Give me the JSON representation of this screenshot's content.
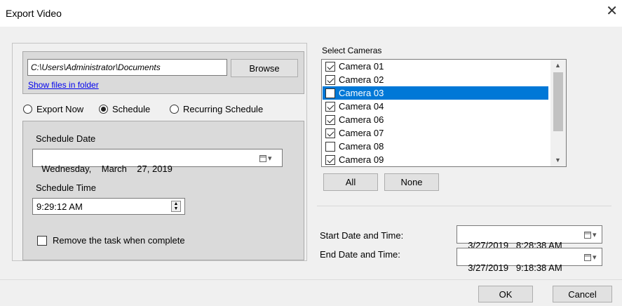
{
  "window": {
    "title": "Export Video",
    "close_glyph": "✕"
  },
  "folder": {
    "path_value": "C:\\Users\\Administrator\\Documents",
    "browse_label": "Browse",
    "show_files_link": "Show files in folder"
  },
  "export_mode": {
    "options": [
      {
        "label": "Export Now",
        "selected": false
      },
      {
        "label": "Schedule",
        "selected": true
      },
      {
        "label": "Recurring Schedule",
        "selected": false
      }
    ]
  },
  "schedule": {
    "date_label": "Schedule Date",
    "date_value": "Wednesday,    March    27, 2019",
    "time_label": "Schedule Time",
    "time_value": "9:29:12 AM",
    "remove_task_label": "Remove the task when complete",
    "remove_task_checked": false
  },
  "cameras": {
    "label": "Select Cameras",
    "items": [
      {
        "label": "Camera 01",
        "checked": true,
        "selected": false
      },
      {
        "label": "Camera 02",
        "checked": true,
        "selected": false
      },
      {
        "label": "Camera 03",
        "checked": false,
        "selected": true
      },
      {
        "label": "Camera 04",
        "checked": true,
        "selected": false
      },
      {
        "label": "Camera 06",
        "checked": true,
        "selected": false
      },
      {
        "label": "Camera 07",
        "checked": true,
        "selected": false
      },
      {
        "label": "Camera 08",
        "checked": false,
        "selected": false
      },
      {
        "label": "Camera 09",
        "checked": true,
        "selected": false
      }
    ],
    "all_label": "All",
    "none_label": "None"
  },
  "range": {
    "start_label": "Start Date and Time:",
    "start_value": "3/27/2019   8:28:38 AM",
    "end_label": "End Date and Time:",
    "end_value": "3/27/2019   9:18:38 AM"
  },
  "footer": {
    "ok_label": "OK",
    "cancel_label": "Cancel"
  },
  "colors": {
    "selection": "#0078d7",
    "link": "#0000ee",
    "panel": "#dadada"
  }
}
